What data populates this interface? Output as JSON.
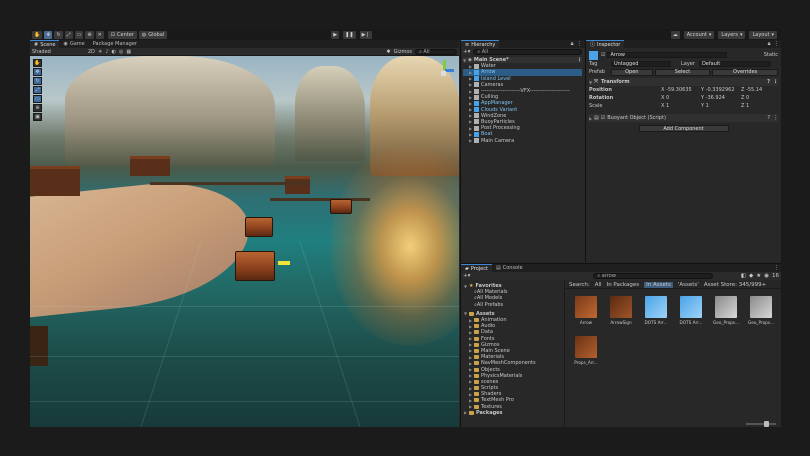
{
  "toolbar": {
    "center_label": "Center",
    "global_label": "Global",
    "account_label": "Account",
    "layers_label": "Layers",
    "layout_label": "Layout"
  },
  "scene_panel": {
    "tabs": [
      {
        "label": "Scene"
      },
      {
        "label": "Game"
      },
      {
        "label": "Package Manager"
      }
    ],
    "shading_label": "Shaded",
    "mode_2d_label": "2D",
    "gizmos_label": "Gizmos",
    "search_placeholder": "All"
  },
  "hierarchy": {
    "tab_label": "Hierarchy",
    "search_placeholder": "All",
    "scene_name": "Main Scene*",
    "items": [
      {
        "label": "Water",
        "color": "grey",
        "indent": 1
      },
      {
        "label": "Arrow",
        "color": "blue",
        "indent": 1,
        "selected": true
      },
      {
        "label": "Island Level",
        "color": "blue",
        "indent": 1
      },
      {
        "label": "Cameras",
        "color": "grey",
        "indent": 1
      },
      {
        "label": "----------------------VFX----------------------",
        "color": "grey",
        "indent": 1
      },
      {
        "label": "Culling",
        "color": "grey",
        "indent": 1
      },
      {
        "label": "AppManager",
        "color": "blue",
        "indent": 1
      },
      {
        "label": "Clouds Variant",
        "color": "blue",
        "indent": 1
      },
      {
        "label": "WindZone",
        "color": "grey",
        "indent": 1
      },
      {
        "label": "BuoyParticles",
        "color": "grey",
        "indent": 1
      },
      {
        "label": "Post Processing",
        "color": "grey",
        "indent": 1
      },
      {
        "label": "Boat",
        "color": "blue",
        "indent": 1
      },
      {
        "label": "Main Camera",
        "color": "grey",
        "indent": 1
      }
    ]
  },
  "inspector": {
    "tab_label": "Inspector",
    "object_name": "Arrow",
    "static_label": "Static",
    "tag_label": "Tag",
    "tag_value": "Untagged",
    "layer_label": "Layer",
    "layer_value": "Default",
    "prefab_label": "Prefab",
    "open_label": "Open",
    "select_label": "Select",
    "overrides_label": "Overrides",
    "transform_label": "Transform",
    "position_label": "Position",
    "rotation_label": "Rotation",
    "scale_label": "Scale",
    "position": {
      "x": "-59.30635",
      "y": "-0.3392962",
      "z": "-55.14"
    },
    "rotation": {
      "x": "0",
      "y": "-36.924",
      "z": "0"
    },
    "scale": {
      "x": "1",
      "y": "1",
      "z": "1"
    },
    "component_label": "Buoyant Object (Script)",
    "add_component_label": "Add Component"
  },
  "project": {
    "tabs": [
      {
        "label": "Project"
      },
      {
        "label": "Console"
      }
    ],
    "search_value": "arrow",
    "filter": {
      "search_label": "Search:",
      "all": "All",
      "in_packages": "In Packages",
      "in_assets": "In Assets",
      "assets_quoted": "'Assets'",
      "asset_store": "Asset Store: 345/999+"
    },
    "favorites_label": "Favorites",
    "favorites": [
      "All Materials",
      "All Models",
      "All Prefabs"
    ],
    "assets_label": "Assets",
    "folders": [
      "Animation",
      "Audio",
      "Data",
      "Fonts",
      "Gizmos",
      "Main Scene",
      "Materials",
      "NavMeshComponents",
      "Objects",
      "PhysicsMaterials",
      "scenes",
      "Scripts",
      "Shaders",
      "TextMesh Pro",
      "Textures"
    ],
    "packages_label": "Packages",
    "assets": [
      {
        "label": "Arrow"
      },
      {
        "label": "ArrowSign"
      },
      {
        "label": "DOTS Arr..."
      },
      {
        "label": "DOTS Arr..."
      },
      {
        "label": "Geo_Props..."
      },
      {
        "label": "Geo_Props..."
      },
      {
        "label": "Props_Arr..."
      }
    ],
    "count_label": "16"
  },
  "colors": {
    "accent": "#3d86d4",
    "selection": "#2c5d87",
    "icon_blue": "#4aa3e8"
  }
}
